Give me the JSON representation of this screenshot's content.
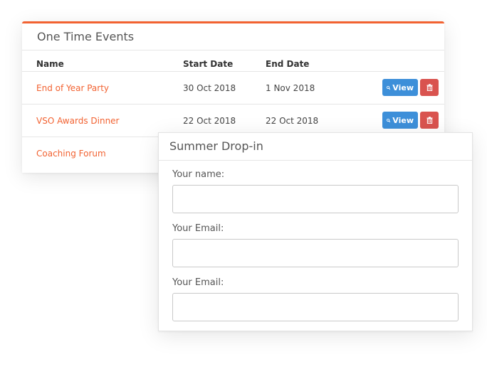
{
  "events": {
    "title": "One Time Events",
    "columns": {
      "name": "Name",
      "start": "Start Date",
      "end": "End Date"
    },
    "rows": [
      {
        "name": "End of Year Party",
        "start": "30 Oct 2018",
        "end": "1 Nov 2018",
        "view_label": "View"
      },
      {
        "name": "VSO Awards Dinner",
        "start": "22 Oct 2018",
        "end": "22 Oct 2018",
        "view_label": "View"
      },
      {
        "name": "Coaching Forum",
        "start": "",
        "end": ""
      }
    ]
  },
  "form": {
    "title": "Summer Drop-in",
    "fields": [
      {
        "label": "Your name:",
        "value": ""
      },
      {
        "label": "Your Email:",
        "value": ""
      },
      {
        "label": "Your Email:",
        "value": ""
      }
    ]
  },
  "colors": {
    "accent": "#f26231",
    "view_button": "#3d8fd9",
    "delete_button": "#d9534f"
  },
  "icons": [
    "search-icon",
    "trash-icon"
  ]
}
